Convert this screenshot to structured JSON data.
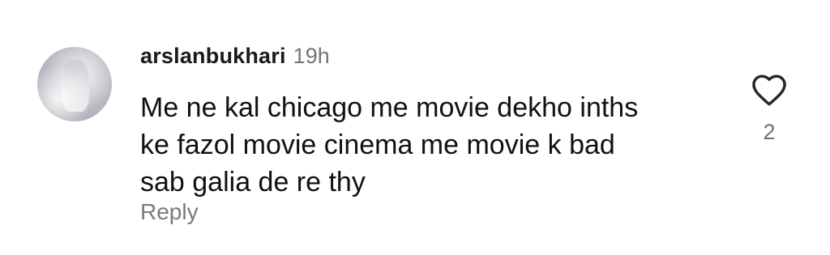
{
  "comment": {
    "avatar_icon": "user-avatar-photo",
    "username": "arslanbukhari",
    "timestamp": "19h",
    "text_lines": [
      "Me ne kal chicago me movie dekho inths",
      "ke fazol movie cinema me movie k bad",
      "sab galia de re thy"
    ],
    "reply_label": "Reply",
    "like_icon": "heart-outline-icon",
    "like_count": "2"
  },
  "colors": {
    "background": "#ffffff",
    "username": "#1b1b1b",
    "timestamp": "#757575",
    "body_text": "#111111",
    "reply": "#7a7a7a",
    "like_count": "#6e6e6e",
    "heart_stroke": "#262626"
  }
}
